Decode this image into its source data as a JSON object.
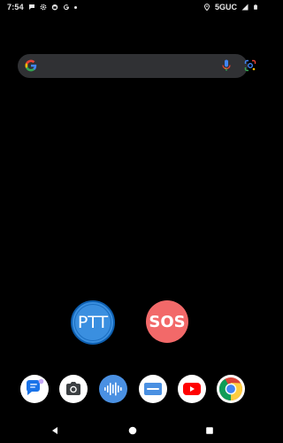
{
  "status_bar": {
    "time": "7:54",
    "network": "5GUC",
    "notification_icons": [
      "chat-icon",
      "gear-icon",
      "store-icon",
      "google-icon",
      "dot-icon"
    ],
    "system_icons": [
      "location-icon",
      "signal-icon",
      "battery-icon"
    ]
  },
  "search_bar": {
    "icons": [
      "google-logo-icon",
      "microphone-icon",
      "lens-icon"
    ]
  },
  "widgets": {
    "ptt_label": "PTT",
    "sos_label": "SOS",
    "colors": {
      "ptt": "#3a8fe0",
      "sos": "#f26969"
    }
  },
  "dock": {
    "apps": [
      "messages",
      "camera",
      "voice-recorder",
      "files",
      "youtube",
      "chrome"
    ]
  },
  "nav_bar": {
    "buttons": [
      "back",
      "home",
      "recents"
    ]
  }
}
